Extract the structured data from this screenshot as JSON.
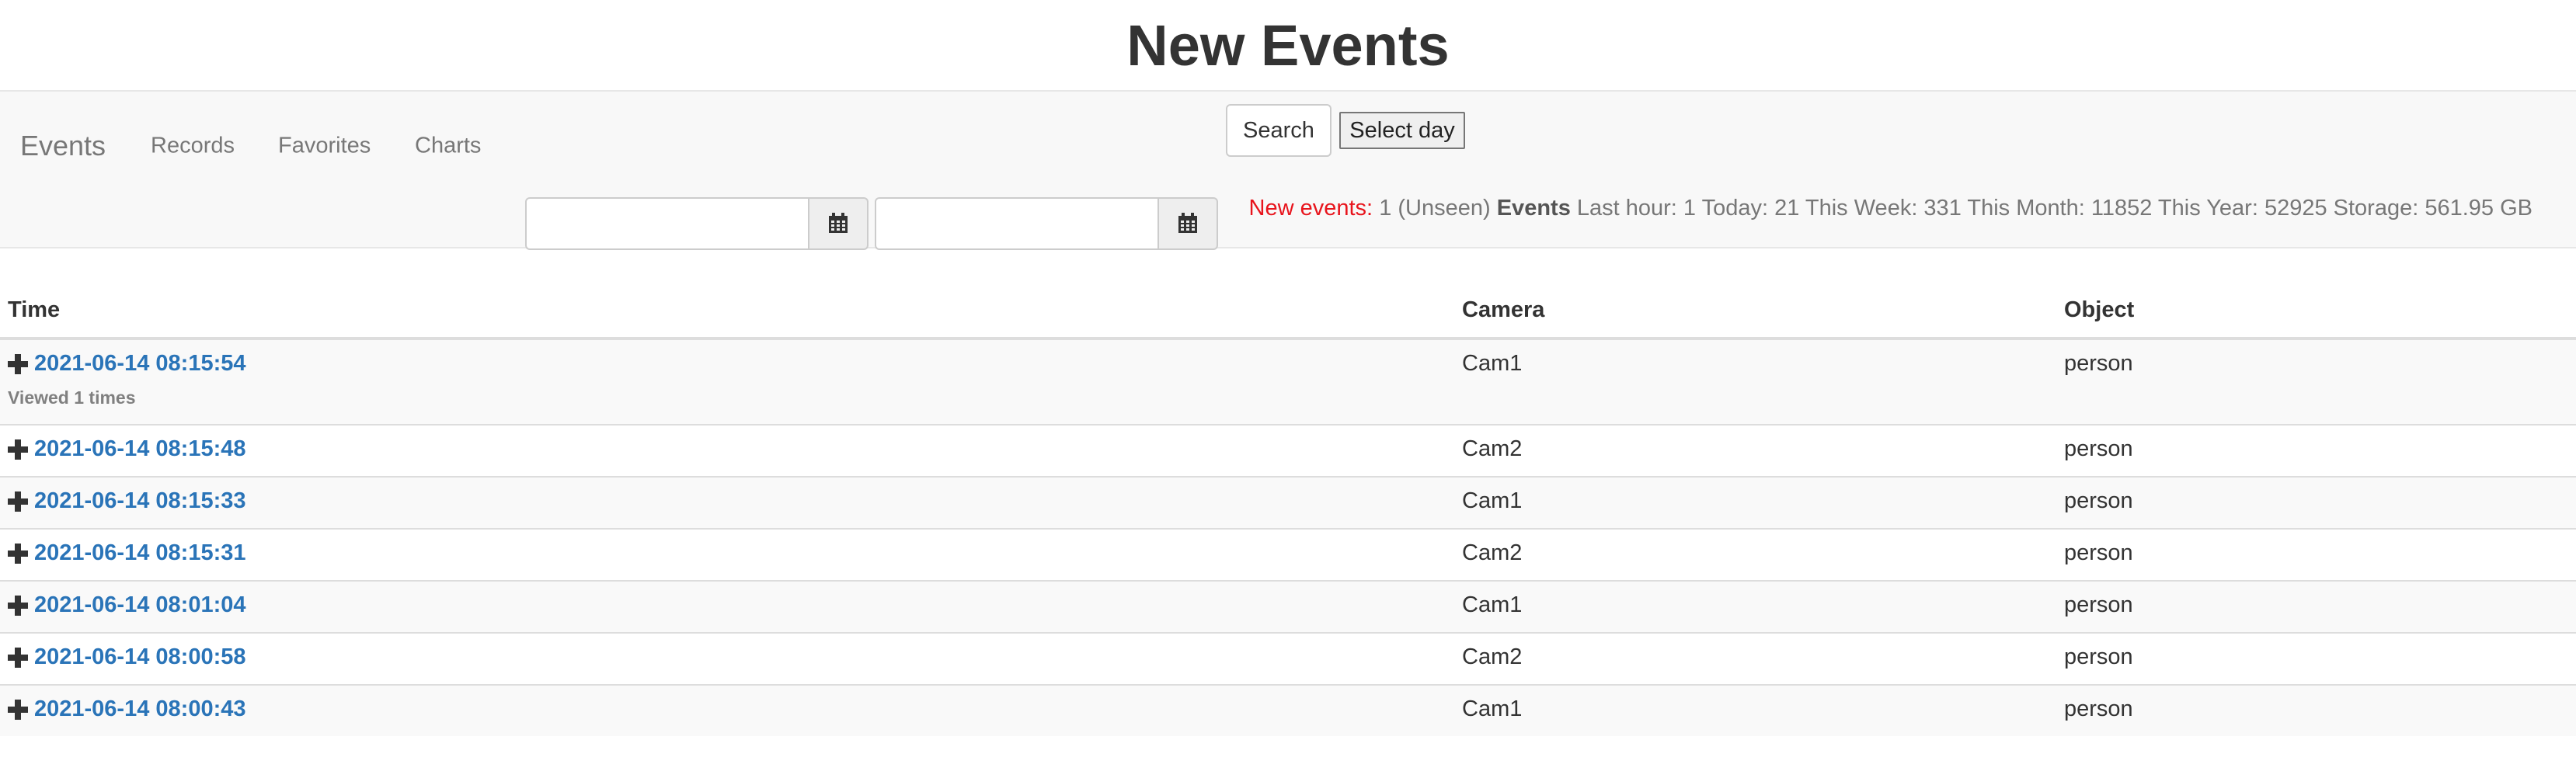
{
  "page": {
    "title": "New Events"
  },
  "navbar": {
    "brand": "Events",
    "links": [
      "Records",
      "Favorites",
      "Charts"
    ],
    "date_from": {
      "value": "",
      "placeholder": ""
    },
    "date_to": {
      "value": "",
      "placeholder": ""
    },
    "search_label": "Search",
    "select_day_label": "Select day"
  },
  "stats": {
    "new_label": "New events:",
    "new_text": "1 (Unseen)",
    "events_label": "Events",
    "summary": "Last hour: 1 Today: 21 This Week: 331 This Month: 11852 This Year: 52925 Storage: 561.95 GB"
  },
  "table": {
    "headers": [
      "Time",
      "Camera",
      "Object"
    ],
    "rows": [
      {
        "time": "2021-06-14 08:15:54",
        "camera": "Cam1",
        "object": "person",
        "viewed": "Viewed 1 times"
      },
      {
        "time": "2021-06-14 08:15:48",
        "camera": "Cam2",
        "object": "person"
      },
      {
        "time": "2021-06-14 08:15:33",
        "camera": "Cam1",
        "object": "person"
      },
      {
        "time": "2021-06-14 08:15:31",
        "camera": "Cam2",
        "object": "person"
      },
      {
        "time": "2021-06-14 08:01:04",
        "camera": "Cam1",
        "object": "person"
      },
      {
        "time": "2021-06-14 08:00:58",
        "camera": "Cam2",
        "object": "person"
      },
      {
        "time": "2021-06-14 08:00:43",
        "camera": "Cam1",
        "object": "person"
      }
    ]
  },
  "colors": {
    "link": "#2a74b8",
    "new_events": "#e8141c",
    "navbar_bg": "#f8f8f8"
  },
  "icons": {
    "calendar": "calendar-icon",
    "expand": "plus-icon"
  }
}
